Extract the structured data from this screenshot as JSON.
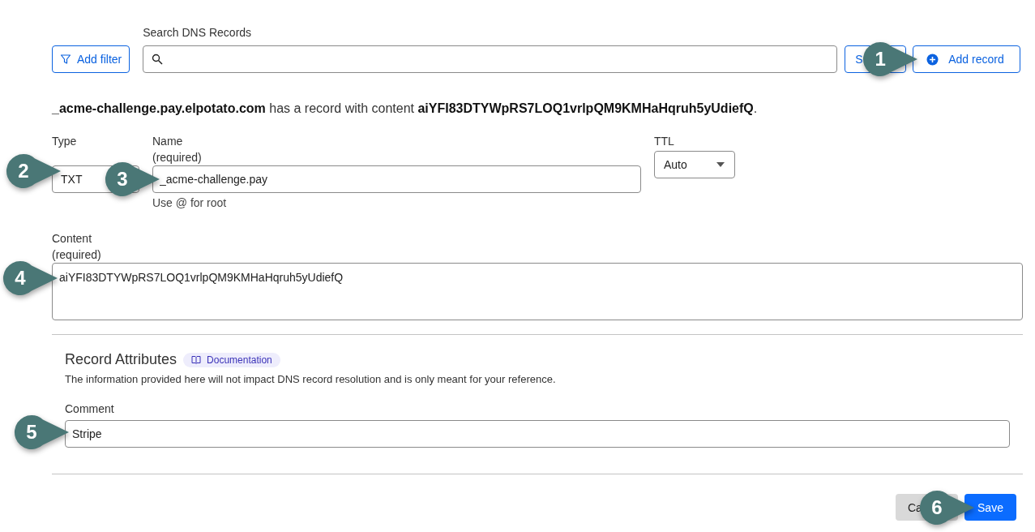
{
  "search_bar": {
    "filter_button": "Add filter",
    "label": "Search DNS Records",
    "search_button": "S",
    "add_button": "Add record",
    "callout": "1"
  },
  "summary": "**_acme-challenge.pay.elpotato.com** has a record with content **aiYFI83DTYWpRS7LOQ1vrlpQM9KMHaHqruh5yUdiefQ**.",
  "record_form": {
    "type": {
      "label": "Type",
      "value": "TXT",
      "callout": "2"
    },
    "name": {
      "label": "Name",
      "required": "(required)",
      "value": "_acme-challenge.pay",
      "hint": "Use @ for root",
      "callout": "3"
    },
    "ttl": {
      "label": "TTL",
      "value": "Auto"
    },
    "content": {
      "label": "Content",
      "required": "(required)",
      "value": "aiYFI83DTYWpRS7LOQ1vrlpQM9KMHaHqruh5yUdiefQ",
      "callout": "4"
    }
  },
  "attributes": {
    "title": "Record Attributes",
    "doc_link": "Documentation",
    "description": "The information provided here will not impact DNS record resolution and is only meant for your reference.",
    "comment": {
      "label": "Comment",
      "value": "Stripe",
      "callout": "5"
    }
  },
  "actions": {
    "cancel": "Ca",
    "save": "Save",
    "callout": "6"
  }
}
